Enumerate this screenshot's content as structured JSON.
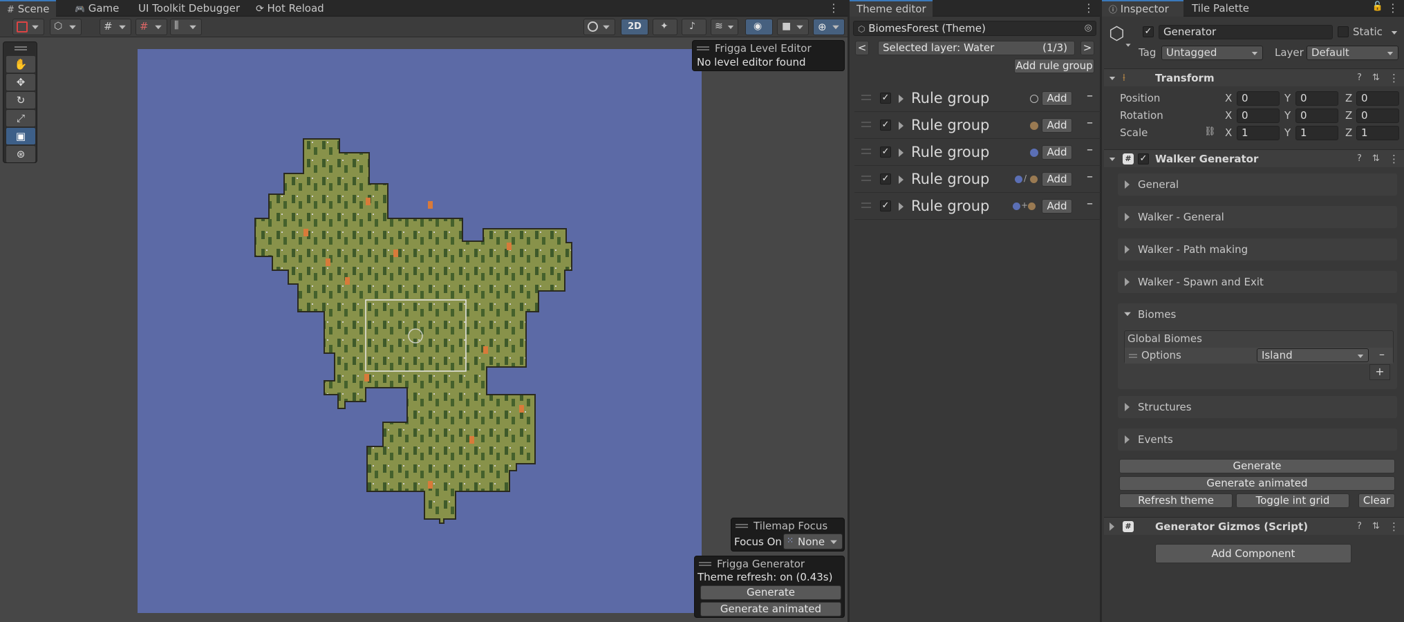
{
  "scene_tabs": [
    {
      "icon": "grid-icon",
      "label": "Scene"
    },
    {
      "icon": "gamepad-icon",
      "label": "Game"
    },
    {
      "label": "UI Toolkit Debugger"
    },
    {
      "icon": "reload-icon",
      "label": "Hot Reload"
    }
  ],
  "scene_toolbar": {
    "mode_2d": "2D"
  },
  "scene": {
    "water_color": "#5c6aa6",
    "grass_color": "#88924a"
  },
  "level_editor_overlay": {
    "title": "Frigga Level Editor",
    "message": "No level editor found"
  },
  "tilemap_focus_overlay": {
    "title": "Tilemap Focus",
    "focus_label": "Focus On",
    "focus_value": "None"
  },
  "generator_overlay": {
    "title": "Frigga Generator",
    "status": "Theme refresh: on (0.43s)",
    "generate": "Generate",
    "generate_animated": "Generate animated"
  },
  "theme_editor": {
    "tab": "Theme editor",
    "theme_name": "BiomesForest (Theme)",
    "prev": "<",
    "next": ">",
    "selected_layer": "Selected layer: Water",
    "layer_count": "(1/3)",
    "add_rule_group": "Add rule group",
    "rule_groups": [
      {
        "label": "Rule group",
        "add": "Add",
        "remove": "–",
        "color": "empty"
      },
      {
        "label": "Rule group",
        "add": "Add",
        "remove": "–",
        "color": "brown"
      },
      {
        "label": "Rule group",
        "add": "Add",
        "remove": "–",
        "color": "blue"
      },
      {
        "label": "Rule group",
        "add": "Add",
        "remove": "–",
        "color": "blue/brown"
      },
      {
        "label": "Rule group",
        "add": "Add",
        "remove": "–",
        "color": "blue+brown"
      }
    ]
  },
  "inspector": {
    "tabs": [
      "Inspector",
      "Tile Palette"
    ],
    "object_name": "Generator",
    "static_label": "Static",
    "tag_label": "Tag",
    "tag_value": "Untagged",
    "layer_label": "Layer",
    "layer_value": "Default",
    "transform": {
      "title": "Transform",
      "rows": [
        {
          "label": "Position",
          "x": "0",
          "y": "0",
          "z": "0"
        },
        {
          "label": "Rotation",
          "x": "0",
          "y": "0",
          "z": "0"
        },
        {
          "label": "Scale",
          "x": "1",
          "y": "1",
          "z": "1"
        }
      ],
      "axis_x": "X",
      "axis_y": "Y",
      "axis_z": "Z"
    },
    "walker_generator": {
      "title": "Walker Generator",
      "foldouts": [
        "General",
        "Walker - General",
        "Walker - Path making",
        "Walker - Spawn and Exit"
      ],
      "biomes_title": "Biomes",
      "global_biomes": "Global Biomes",
      "options_label": "Options",
      "options_value": "Island",
      "remove": "–",
      "add": "+",
      "structures": "Structures",
      "events": "Events",
      "generate": "Generate",
      "generate_animated": "Generate animated",
      "refresh_theme": "Refresh theme",
      "toggle_int_grid": "Toggle int grid",
      "clear": "Clear"
    },
    "gizmos": {
      "title": "Generator Gizmos (Script)"
    },
    "add_component": "Add Component"
  },
  "colors": {
    "accent": "#3a79bb",
    "water_swatch": "#5b6fb5",
    "ground_swatch": "#9a7a52"
  }
}
